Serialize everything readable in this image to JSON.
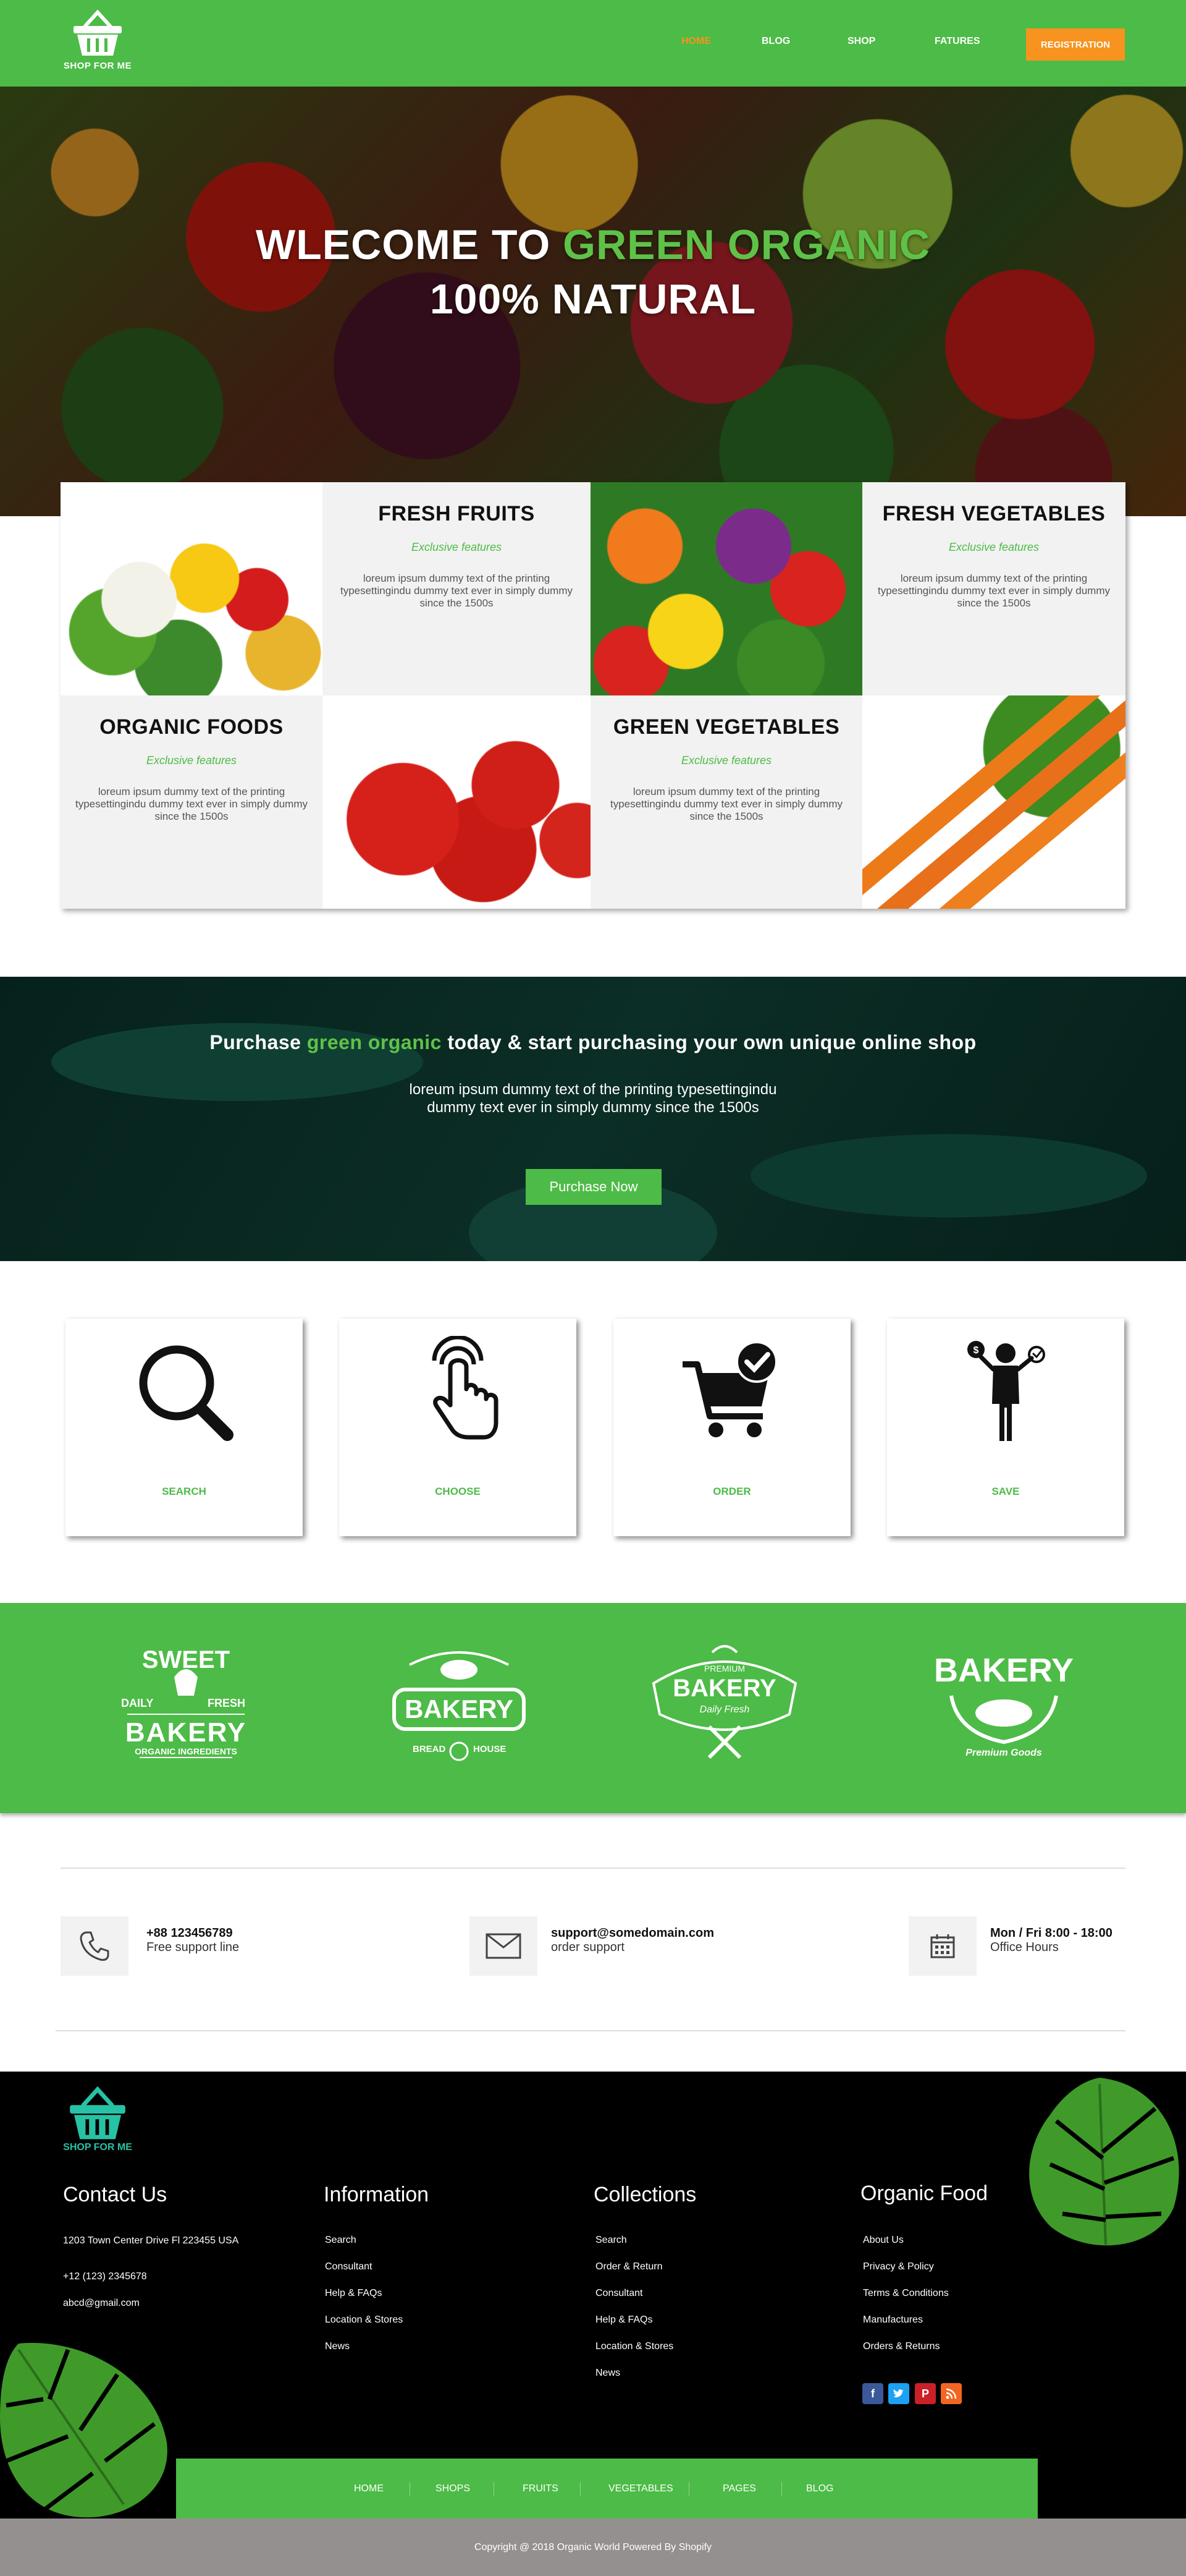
{
  "nav": {
    "logo_text": "SHOP FOR ME",
    "items": [
      "HOME",
      "BLOG",
      "SHOP",
      "FATURES"
    ],
    "registration": "REGISTRATION"
  },
  "hero": {
    "line1_white": "WLECOME TO ",
    "line1_green": "GREEN ORGANIC",
    "line2": "100% NATURAL"
  },
  "features": [
    {
      "title": "FRESH FRUITS",
      "subtitle": "Exclusive features",
      "text": "loreum ipsum dummy text of the printing typesettingindu dummy text ever in simply dummy since the 1500s"
    },
    {
      "title": "FRESH VEGETABLES",
      "subtitle": "Exclusive features",
      "text": "loreum ipsum dummy text of the printing typesettingindu dummy text ever in simply dummy since the 1500s"
    },
    {
      "title": "ORGANIC FOODS",
      "subtitle": "Exclusive features",
      "text": "loreum ipsum dummy text of the printing typesettingindu dummy text ever in simply dummy since the 1500s"
    },
    {
      "title": "GREEN VEGETABLES",
      "subtitle": "Exclusive features",
      "text": "loreum ipsum dummy text of the printing typesettingindu dummy text ever in simply dummy since the 1500s"
    }
  ],
  "promo": {
    "title_before": "Purchase ",
    "title_green": "green organic",
    "title_after": " today & start purchasing your own unique online shop",
    "text": "loreum ipsum dummy text of the printing typesettingindu dummy text ever in simply dummy since the 1500s",
    "button": "Purchase Now"
  },
  "steps": [
    {
      "label": "SEARCH",
      "icon": "magnifier-icon"
    },
    {
      "label": "CHOOSE",
      "icon": "hand-pointer-icon"
    },
    {
      "label": "ORDER",
      "icon": "cart-check-icon"
    },
    {
      "label": "SAVE",
      "icon": "businessman-money-icon"
    }
  ],
  "bakery_logos": [
    {
      "top": "SWEET",
      "left": "DAILY",
      "right": "FRESH",
      "main": "BAKERY",
      "bottom": "ORGANIC INGREDIENTS"
    },
    {
      "main": "BAKERY",
      "left": "BREAD",
      "right": "HOUSE"
    },
    {
      "top": "PREMIUM",
      "main": "BAKERY",
      "bottom": "Daily Fresh"
    },
    {
      "main": "BAKERY",
      "bottom": "Premium Goods"
    }
  ],
  "contact": [
    {
      "main": "+88 123456789",
      "sub": "Free support line",
      "icon": "phone-icon"
    },
    {
      "main": "support@somedomain.com",
      "sub": "order support",
      "icon": "envelope-icon"
    },
    {
      "main": "Mon / Fri 8:00 - 18:00",
      "sub": "Office Hours",
      "icon": "calendar-icon"
    }
  ],
  "footer": {
    "logo_text": "SHOP FOR ME",
    "contact_heading": "Contact Us",
    "address": "1203 Town Center Drive Fl 223455 USA",
    "phone": "+12 (123) 2345678",
    "email": "abcd@gmail.com",
    "information_heading": "Information",
    "information": [
      "Search",
      "Consultant",
      "Help & FAQs",
      "Location & Stores",
      "News"
    ],
    "collections_heading": "Collections",
    "collections": [
      "Search",
      "Order & Return",
      "Consultant",
      "Help & FAQs",
      "Location & Stores",
      "News"
    ],
    "organic_heading": "Organic Food",
    "organic": [
      "About Us",
      "Privacy & Policy",
      "Terms & Conditions",
      "Manufactures",
      "Orders & Returns"
    ],
    "social": [
      {
        "icon": "facebook-icon",
        "glyph": "f",
        "color": "#3b5998"
      },
      {
        "icon": "twitter-icon",
        "glyph": "t",
        "color": "#1da1f2"
      },
      {
        "icon": "pinterest-icon",
        "glyph": "p",
        "color": "#cb2027"
      },
      {
        "icon": "rss-icon",
        "glyph": "r",
        "color": "#f26522"
      }
    ]
  },
  "bottom_nav": [
    "HOME",
    "SHOPS",
    "FRUITS",
    "VEGETABLES",
    "PAGES",
    "BLOG"
  ],
  "copyright": "Copyright @ 2018 Organic World Powered By Shopify",
  "colors": {
    "brand_green": "#4dbb47",
    "accent_orange": "#f7931e",
    "footer_teal": "#27c2a5"
  }
}
